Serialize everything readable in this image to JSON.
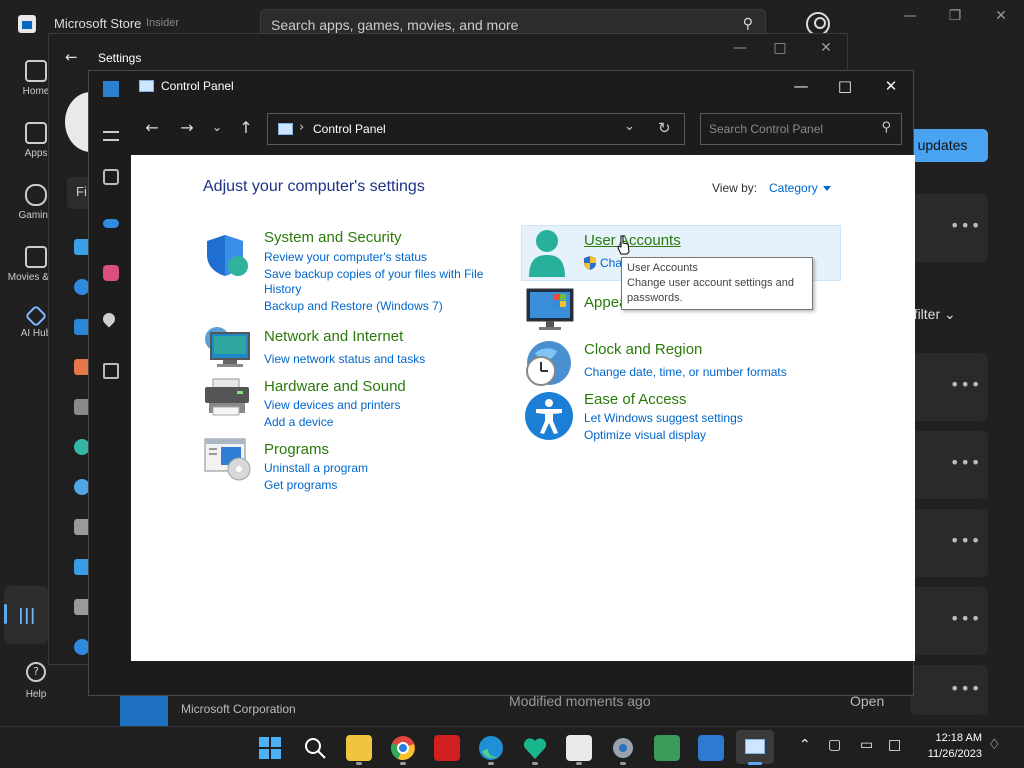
{
  "store": {
    "title": "Microsoft Store",
    "badge": "Insider",
    "search_placeholder": "Search apps, games, movies, and more",
    "nav": [
      {
        "label": "Home",
        "icon": "home-icon"
      },
      {
        "label": "Apps",
        "icon": "apps-icon"
      },
      {
        "label": "Gaming",
        "icon": "gaming-icon"
      },
      {
        "label": "Movies & TV",
        "icon": "movies-icon"
      },
      {
        "label": "AI Hub",
        "icon": "ai-hub-icon"
      }
    ],
    "help_label": "Help",
    "get_updates_label": "et updates",
    "filter_label": "d filter",
    "row": {
      "publisher": "Microsoft Corporation",
      "modified": "Modified moments ago",
      "open_label": "Open"
    }
  },
  "settings": {
    "title": "Settings",
    "find_label": "Fi"
  },
  "control_panel": {
    "title": "Control Panel",
    "address": "Control Panel",
    "search_placeholder": "Search Control Panel",
    "heading": "Adjust your computer's settings",
    "view_by_label": "View by:",
    "view_by_value": "Category",
    "categories_left": [
      {
        "title": "System and Security",
        "links": [
          "Review your computer's status",
          "Save backup copies of your files with File",
          "History",
          "Backup and Restore (Windows 7)"
        ]
      },
      {
        "title": "Network and Internet",
        "links": [
          "View network status and tasks"
        ]
      },
      {
        "title": "Hardware and Sound",
        "links": [
          "View devices and printers",
          "Add a device"
        ]
      },
      {
        "title": "Programs",
        "links": [
          "Uninstall a program",
          "Get programs"
        ]
      }
    ],
    "categories_right": [
      {
        "title": "User Accounts",
        "links": [
          "Cha"
        ]
      },
      {
        "title": "Appearance and Personalization",
        "links": []
      },
      {
        "title": "Clock and Region",
        "links": [
          "Change date, time, or number formats"
        ]
      },
      {
        "title": "Ease of Access",
        "links": [
          "Let Windows suggest settings",
          "Optimize visual display"
        ]
      }
    ],
    "tooltip": {
      "title": "User Accounts",
      "body": "Change user account settings and passwords."
    }
  },
  "taskbar": {
    "time": "12:18 AM",
    "date": "11/26/2023"
  },
  "colors": {
    "category_title": "#2b7a0b",
    "link": "#0066cc",
    "heading": "#1e3287",
    "accent": "#4aa3f0"
  }
}
